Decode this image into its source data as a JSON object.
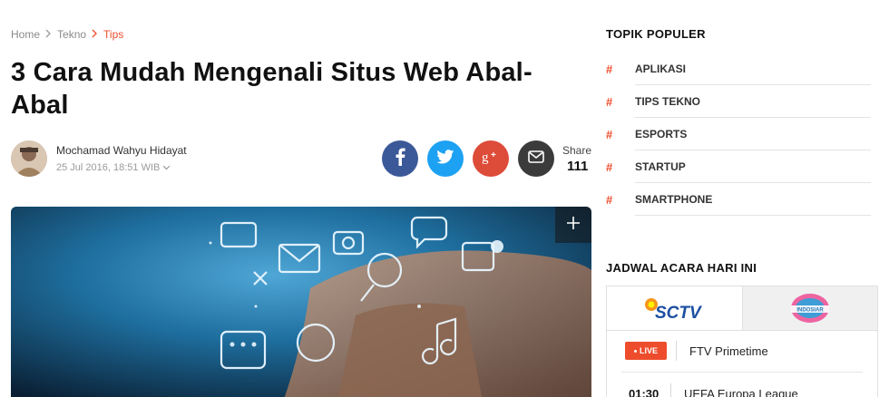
{
  "breadcrumb": {
    "home": "Home",
    "section": "Tekno",
    "current": "Tips"
  },
  "article": {
    "title": "3 Cara Mudah Mengenali Situs Web Abal-Abal",
    "author": "Mochamad Wahyu Hidayat",
    "date": "25 Jul 2016, 18:51 WIB"
  },
  "share": {
    "label": "Share",
    "count": "111",
    "icons": [
      "facebook-icon",
      "twitter-icon",
      "google-plus-icon",
      "mail-icon"
    ]
  },
  "sidebar": {
    "topics_heading": "TOPIK POPULER",
    "topics": [
      {
        "hash": "#",
        "label": "APLIKASI"
      },
      {
        "hash": "#",
        "label": "TIPS TEKNO"
      },
      {
        "hash": "#",
        "label": "ESPORTS"
      },
      {
        "hash": "#",
        "label": "STARTUP"
      },
      {
        "hash": "#",
        "label": "SMARTPHONE"
      }
    ],
    "schedule_heading": "JADWAL ACARA HARI INI",
    "channels": [
      {
        "logo_text": "SCTV",
        "active": true
      },
      {
        "logo_text": "INDOSIAR",
        "active": false
      }
    ],
    "schedule": [
      {
        "badge": "LIVE",
        "title": "FTV Primetime"
      },
      {
        "time": "01:30",
        "title": "UEFA Europa League"
      }
    ]
  },
  "colors": {
    "accent": "#ee4d2d",
    "facebook": "#3b5998",
    "twitter": "#1da1f2",
    "google_plus": "#dd4b39",
    "mail": "#3b3b3b"
  }
}
